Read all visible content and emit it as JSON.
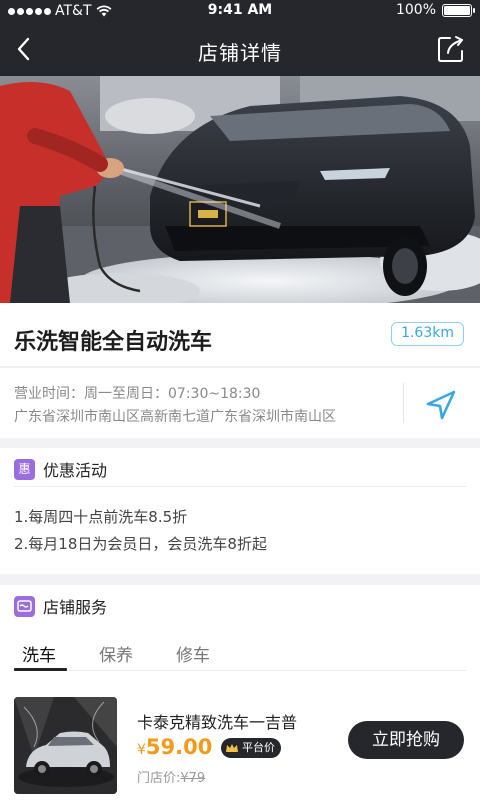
{
  "status_bar": {
    "carrier": "AT&T",
    "time": "9:41 AM",
    "battery": "100%"
  },
  "nav": {
    "title": "店铺详情"
  },
  "store": {
    "name": "乐洗智能全自动洗车",
    "distance": "1.63km",
    "hours": "营业时间：周一至周日：07:30~18:30",
    "address": "广东省深圳市南山区高新南七道广东省深圳市南山区"
  },
  "promotions": {
    "badge": "惠",
    "title": "优惠活动",
    "items": [
      "1.每周四十点前洗车8.5折",
      "2.每月18日为会员日，会员洗车8折起"
    ]
  },
  "services": {
    "title": "店铺服务",
    "tabs": [
      "洗车",
      "保养",
      "修车"
    ],
    "active_tab": 0,
    "items": [
      {
        "name": "卡泰克精致洗车一吉普",
        "price_symbol": "¥",
        "price": "59.00",
        "badge": "平台价",
        "store_price_label": "门店价:",
        "store_price": "¥79",
        "buy_label": "立即抢购"
      }
    ]
  },
  "colors": {
    "dark": "#25272c",
    "accent_orange": "#f39a1b",
    "accent_blue": "#3aa8e0",
    "badge_purple": "#9a6ee0"
  }
}
